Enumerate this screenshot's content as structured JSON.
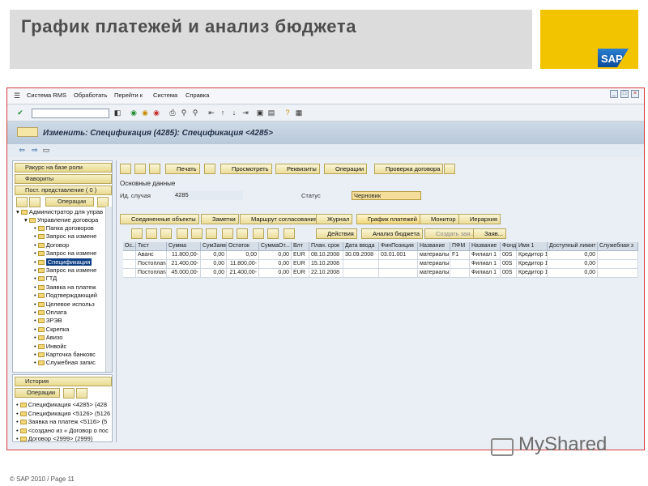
{
  "slide": {
    "title": "График платежей и анализ бюджета",
    "brand": "SAP",
    "watermark": "MyShared",
    "footer": "© SAP 2010 / Page 11"
  },
  "window": {
    "menu": [
      "Система RMS",
      "Обработать",
      "Перейти к",
      "Система",
      "Справка"
    ],
    "header_title": "Изменить: Спецификация (4285): Спецификация <4285>"
  },
  "left_panel": {
    "buttons": [
      "Ракурс на базе роли",
      "Фавориты",
      "Пост. представление ( 0 )"
    ],
    "ops_label": "Операции",
    "root": "Администратор для управ",
    "group": "Управление договора",
    "items": [
      "Папка договоров",
      "Запрос на измене",
      "Договор",
      "Запрос на измене",
      "Спецификация",
      "Запрос на измене",
      "ГТД",
      "Заявка на платеж",
      "Подтверждающий",
      "Целевое использ",
      "Оплата",
      "ЗРЭВ",
      "Скрепка",
      "Авизо",
      "Инвойс",
      "Карточка банковс",
      "Служебная запис"
    ],
    "selected_index": 4,
    "history_label": "История",
    "history_ops_label": "Операции",
    "history": [
      "Спецификация <4285> (428",
      "Спецификация <5126> (5126",
      "Заявка на платеж <5116> (5",
      "<создано из « Договор о пос",
      "Договор <2999> (2999)"
    ]
  },
  "main": {
    "toolbar": [
      "Печать",
      "Просмотреть",
      "Реквизиты",
      "Операции",
      "Проверка договора"
    ],
    "section": "Основные данные",
    "case_label": "Ид. случая",
    "case_value": "4285",
    "status_label": "Статус",
    "status_value": "Черновик",
    "tabs": [
      "Соединенные объекты",
      "Заметки",
      "Маршрут согласования",
      "Журнал",
      "График платежей",
      "Монитор",
      "Иерархия"
    ],
    "active_tab": "График платежей",
    "table_tools": [
      "Действия",
      "Анализ бюджета",
      "Создать зая...",
      "Заяв..."
    ],
    "columns": [
      "Ос...",
      "Ткст",
      "Сумма",
      "СумЗаяв",
      "Остаток",
      "СуммаОт...",
      "Влт",
      "План. срок",
      "Дата ввода",
      "ФинПозиция",
      "Название",
      "ПФМ",
      "Название",
      "Фонд",
      "Имя 1",
      "Доступный лимит",
      "Служебная з"
    ],
    "rows": [
      [
        "",
        "Аванс",
        "11.800,00-",
        "0,00",
        "0,00",
        "0,00",
        "EUR",
        "08.10.2008",
        "30.09.2008",
        "03.01.001",
        "материалы",
        "F1",
        "Филиал 1",
        "00S",
        "Кредитор 1",
        "0,00",
        ""
      ],
      [
        "",
        "Постоплата",
        "21.400,00-",
        "0,00",
        "11.800,00-",
        "0,00",
        "EUR",
        "15.10.2008",
        "",
        "",
        "материалы",
        "",
        "Филиал 1",
        "00S",
        "Кредитор 1",
        "0,00",
        ""
      ],
      [
        "",
        "Постоплата",
        "45.000,00-",
        "0,00",
        "21.400,00-",
        "0,00",
        "EUR",
        "22.10.2008",
        "",
        "",
        "материалы",
        "",
        "Филиал 1",
        "00S",
        "Кредитор 1",
        "0,00",
        ""
      ]
    ]
  }
}
